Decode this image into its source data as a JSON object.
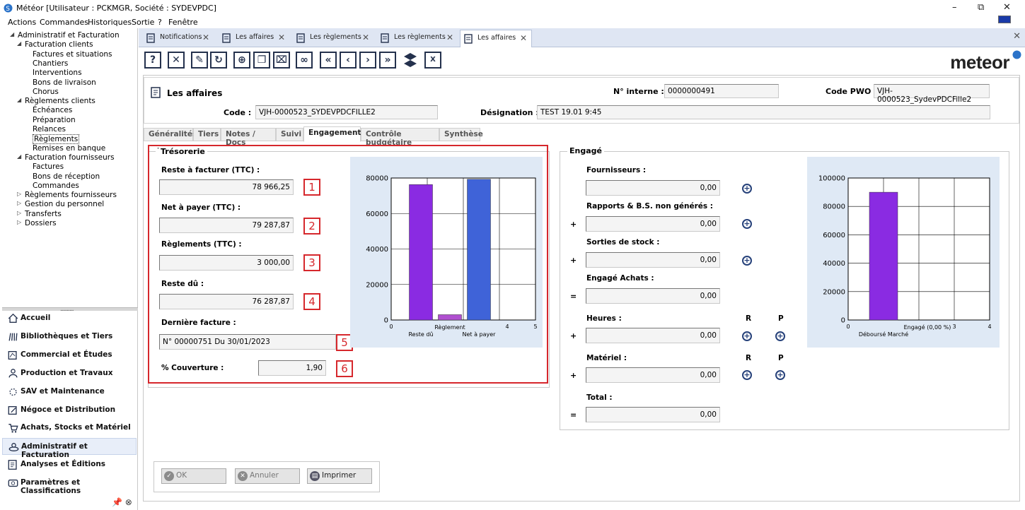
{
  "window": {
    "title": "Météor [Utilisateur : PCKMGR, Société : SYDEVPDC]",
    "menu": [
      "Actions",
      "Commandes",
      "Historiques",
      "Sortie",
      "?",
      "Fenêtre"
    ],
    "minimize": "–",
    "maximize": "⧉",
    "close": "✕"
  },
  "tree": [
    {
      "label": "Administratif et Facturation",
      "level": 0,
      "arrow": "◢"
    },
    {
      "label": "Facturation clients",
      "level": 1,
      "arrow": "◢"
    },
    {
      "label": "Factures et situations",
      "level": 2
    },
    {
      "label": "Chantiers",
      "level": 2
    },
    {
      "label": "Interventions",
      "level": 2
    },
    {
      "label": "Bons de livraison",
      "level": 2
    },
    {
      "label": "Chorus",
      "level": 2
    },
    {
      "label": "Règlements clients",
      "level": 1,
      "arrow": "◢"
    },
    {
      "label": "Échéances",
      "level": 2
    },
    {
      "label": "Préparation",
      "level": 2
    },
    {
      "label": "Relances",
      "level": 2
    },
    {
      "label": "Règlements",
      "level": 2,
      "selected": true
    },
    {
      "label": "Remises en banque",
      "level": 2
    },
    {
      "label": "Facturation fournisseurs",
      "level": 1,
      "arrow": "◢"
    },
    {
      "label": "Factures",
      "level": 2
    },
    {
      "label": "Bons de réception",
      "level": 2
    },
    {
      "label": "Commandes",
      "level": 2
    },
    {
      "label": "Règlements fournisseurs",
      "level": 1,
      "arrow": "▷"
    },
    {
      "label": "Gestion du personnel",
      "level": 1,
      "arrow": "▷"
    },
    {
      "label": "Transferts",
      "level": 1,
      "arrow": "▷"
    },
    {
      "label": "Dossiers",
      "level": 1,
      "arrow": "▷"
    }
  ],
  "nav": [
    {
      "label": "Accueil",
      "icon": "home-icon"
    },
    {
      "label": "Bibliothèques et Tiers",
      "icon": "library-icon"
    },
    {
      "label": "Commercial et Études",
      "icon": "commercial-icon"
    },
    {
      "label": "Production et Travaux",
      "icon": "production-icon"
    },
    {
      "label": "SAV et Maintenance",
      "icon": "maintenance-icon"
    },
    {
      "label": "Négoce et Distribution",
      "icon": "trade-icon"
    },
    {
      "label": "Achats, Stocks et Matériel",
      "icon": "cart-icon"
    },
    {
      "label": "Administratif et Facturation",
      "icon": "billing-icon",
      "active": true
    },
    {
      "label": "Analyses et Éditions",
      "icon": "analysis-icon"
    },
    {
      "label": "Paramètres et Classifications",
      "icon": "settings-icon"
    }
  ],
  "nav_grip": "..........",
  "nav_footer": "📌 ⊗",
  "doc_tabs": [
    {
      "label": "Notifications",
      "icon": "notification-icon"
    },
    {
      "label": "Les affaires",
      "icon": "affaires-icon"
    },
    {
      "label": "Les règlements",
      "icon": "reglements-icon"
    },
    {
      "label": "Les règlements",
      "icon": "reglements-icon"
    },
    {
      "label": "Les affaires",
      "icon": "affaires-icon",
      "active": true
    }
  ],
  "tab_close": "✕",
  "brand": "meteor",
  "header": {
    "title": "Les affaires",
    "internal_no_label": "N° interne :",
    "internal_no": "0000000491",
    "pwo_label": "Code PWO :",
    "pwo": "VJH-0000523_SydevPDCFille2",
    "code_label": "Code :",
    "code": "VJH-0000523_SYDEVPDCFILLE2",
    "designation_label": "Désignation :",
    "designation": "TEST 19.01  9:45"
  },
  "form_tabs": [
    "Généralités",
    "Tiers",
    "Notes / Docs",
    "Suivi",
    "Engagement",
    "Contrôle budgétaire",
    "Synthèse"
  ],
  "active_form_tab": "Engagement",
  "tresorerie": {
    "legend": "Trésorerie",
    "reste_facturer_label": "Reste à facturer (TTC) :",
    "reste_facturer": "78 966,25",
    "net_payer_label": "Net à payer (TTC) :",
    "net_payer": "79 287,87",
    "reglements_label": "Règlements (TTC) :",
    "reglements": "3 000,00",
    "reste_du_label": "Reste dû :",
    "reste_du": "76 287,87",
    "derniere_facture_label": "Dernière facture :",
    "derniere_facture": "N° 00000751 Du 30/01/2023",
    "couverture_label": "% Couverture :",
    "couverture": "1,90",
    "badges": [
      "1",
      "2",
      "3",
      "4",
      "5",
      "6"
    ]
  },
  "engage": {
    "legend": "Engagé",
    "fournisseurs_label": "Fournisseurs :",
    "fournisseurs": "0,00",
    "rapports_label": "Rapports & B.S. non générés :",
    "rapports": "0,00",
    "sorties_label": "Sorties de stock :",
    "sorties": "0,00",
    "engage_achats_label": "Engagé Achats :",
    "engage_achats": "0,00",
    "heures_label": "Heures :",
    "heures": "0,00",
    "materiel_label": "Matériel :",
    "materiel": "0,00",
    "total_label": "Total :",
    "total": "0,00",
    "r": "R",
    "p": "P",
    "plus": "+",
    "equals": "=",
    "add": "+"
  },
  "chart_data": [
    {
      "type": "bar",
      "categories": [
        "Reste dû",
        "Règlement",
        "Net à payer"
      ],
      "values": [
        76287.87,
        3000,
        79287.87
      ],
      "colors": [
        "#8a2be2",
        "#b04fd0",
        "#3f63d8"
      ],
      "ylim": [
        0,
        80000
      ],
      "yticks": [
        0,
        20000,
        40000,
        60000,
        80000
      ],
      "xticks": [
        "0",
        "4",
        "5"
      ],
      "title": "",
      "xlabel": "",
      "ylabel": "",
      "grid": true
    },
    {
      "type": "bar",
      "categories": [
        "Déboursé Marché",
        "Engagé (0,00 %)"
      ],
      "values": [
        90000,
        0
      ],
      "colors": [
        "#8a2be2",
        "#3f63d8"
      ],
      "ylim": [
        0,
        100000
      ],
      "yticks": [
        0,
        20000,
        40000,
        60000,
        80000,
        100000
      ],
      "xticks": [
        "0",
        "3",
        "4"
      ],
      "title": "",
      "xlabel": "",
      "ylabel": "",
      "grid": true
    }
  ],
  "buttons": {
    "ok": "OK",
    "cancel": "Annuler",
    "print": "Imprimer"
  }
}
